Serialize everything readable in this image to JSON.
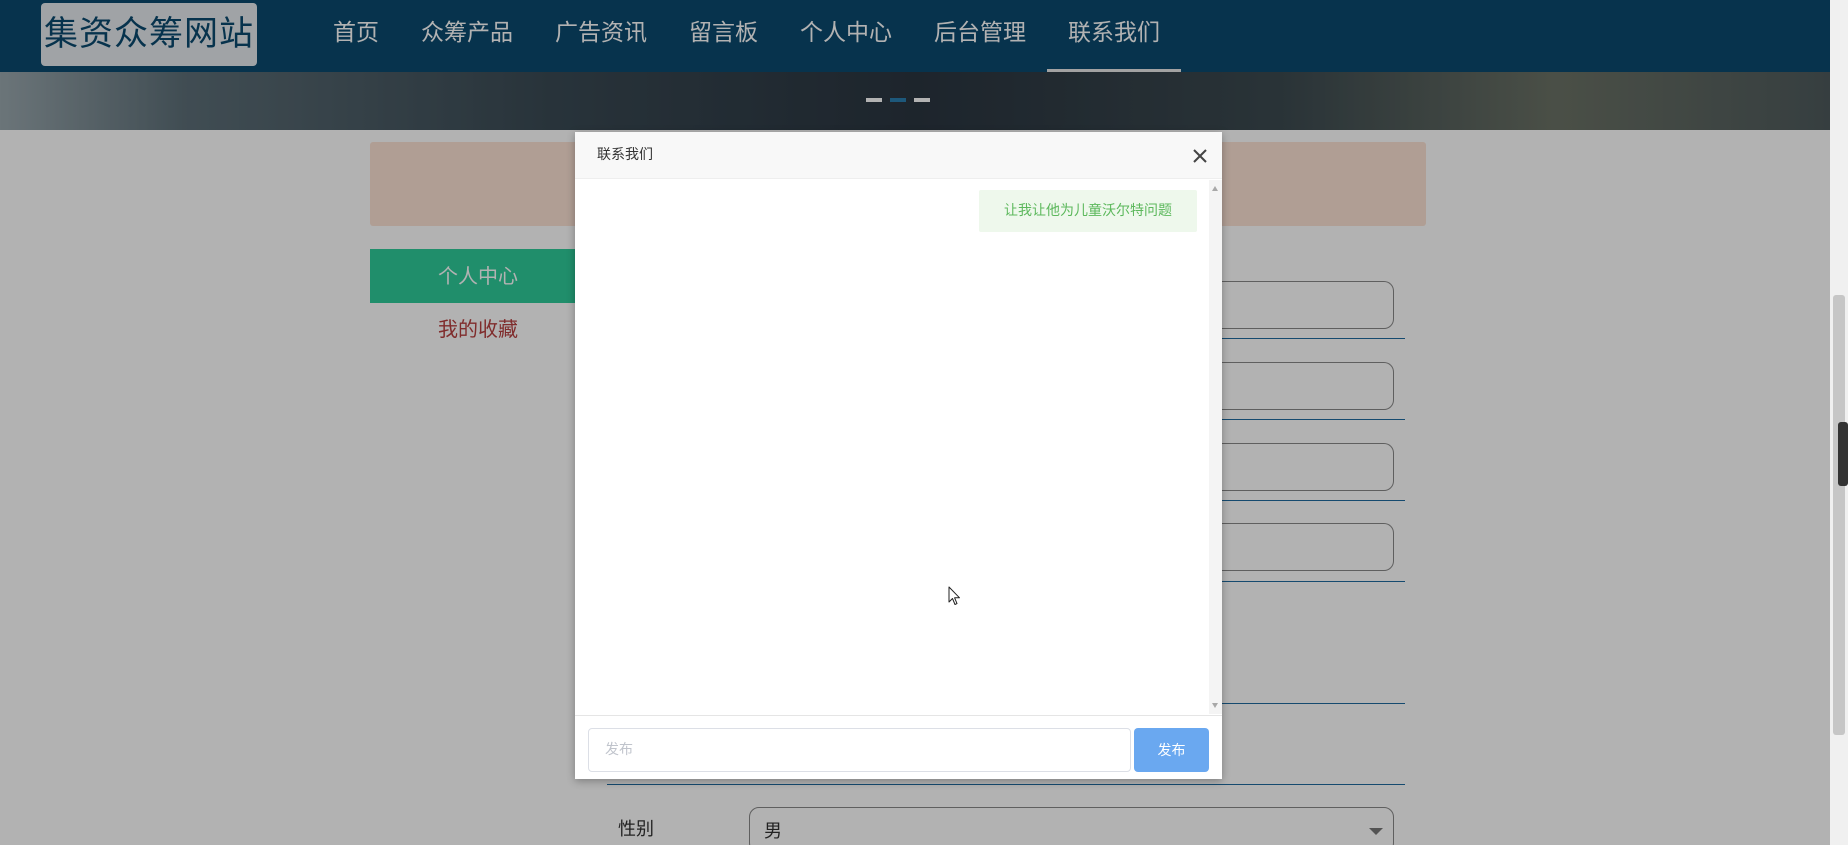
{
  "header": {
    "logo": "集资众筹网站",
    "nav": [
      {
        "label": "首页",
        "active": false
      },
      {
        "label": "众筹产品",
        "active": false
      },
      {
        "label": "广告资讯",
        "active": false
      },
      {
        "label": "留言板",
        "active": false
      },
      {
        "label": "个人中心",
        "active": false
      },
      {
        "label": "后台管理",
        "active": false
      },
      {
        "label": "联系我们",
        "active": true
      }
    ]
  },
  "banner": {
    "slides": 3,
    "active_slide": 2
  },
  "sidebar": {
    "items": [
      {
        "label": "个人中心",
        "active": true
      },
      {
        "label": "我的收藏",
        "active": false
      }
    ]
  },
  "form": {
    "gender": {
      "label": "性别",
      "value": "男"
    }
  },
  "dialog": {
    "title": "联系我们",
    "messages": [
      {
        "text": "让我让他为儿童沃尔特问题",
        "side": "right"
      }
    ],
    "input_placeholder": "发布",
    "send_label": "发布"
  },
  "colors": {
    "header_bg": "#0b4a6f",
    "sidebar_active": "#2ecc9a",
    "send_button": "#6aa8f0",
    "bubble_bg": "#eef8ec",
    "bubble_text": "#5cb85c"
  }
}
